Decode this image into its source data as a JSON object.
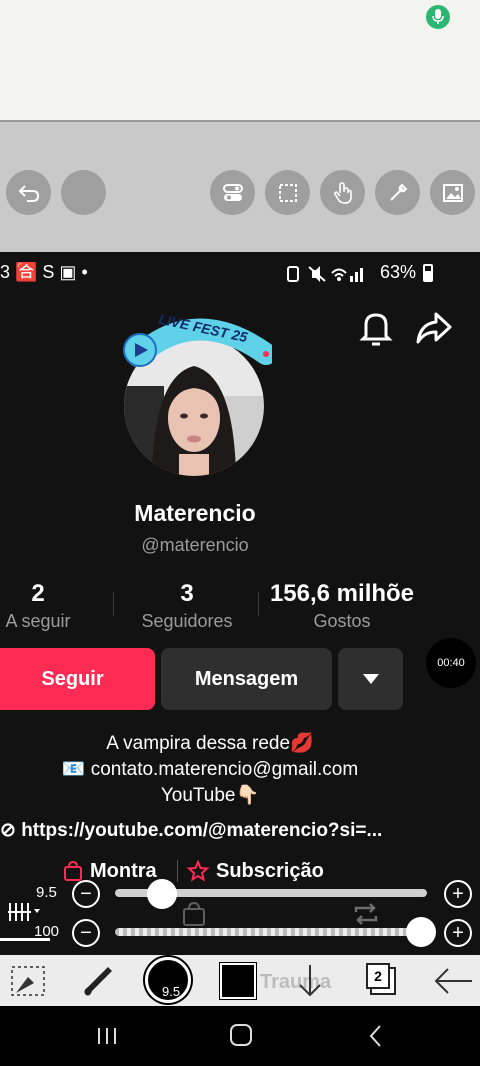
{
  "status_bar": {
    "left_icons": "3 🈴 S ▣ •",
    "battery": "63%"
  },
  "profile": {
    "badge": "LIVE FEST 25",
    "name": "Materencio",
    "handle": "@materencio",
    "stats": [
      {
        "value": "2",
        "label": "A seguir"
      },
      {
        "value": "3",
        "label": "Seguidores"
      },
      {
        "value": "156,6 milhõe",
        "label": "Gostos"
      }
    ]
  },
  "buttons": {
    "follow": "Seguir",
    "message": "Mensagem"
  },
  "timer": "00:40",
  "bio": {
    "line1": "A vampira dessa rede💋",
    "line2": "📧 contato.materencio@gmail.com",
    "line3": "YouTube👇🏻",
    "link": "https://youtube.com/@materencio?si=...",
    "shop": "Montra",
    "subscription": "Subscrição"
  },
  "editor": {
    "brush_size": "9.5",
    "opacity": "100",
    "brush_value_label": "9.5",
    "layers_count": "2",
    "underlay_text": "Trauma"
  },
  "sliders": {
    "size_fraction": 0.15,
    "opacity_fraction": 0.98
  },
  "colors": {
    "accent": "#fe2c55",
    "toolbar": "#c9c9c9",
    "button_dark": "#2f2f2f"
  }
}
